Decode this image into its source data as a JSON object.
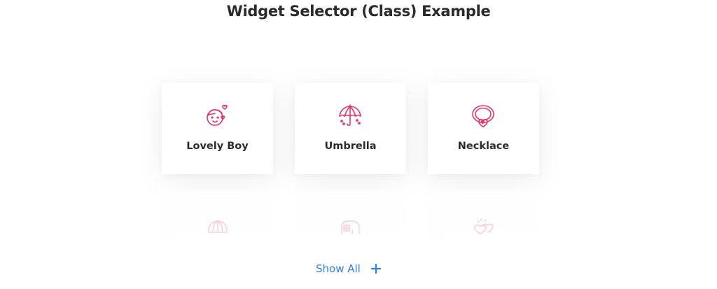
{
  "page": {
    "title": "Widget Selector (Class) Example"
  },
  "cards": [
    {
      "label": "Lovely Boy",
      "icon": "lovely-boy-icon"
    },
    {
      "label": "Umbrella",
      "icon": "umbrella-icon"
    },
    {
      "label": "Necklace",
      "icon": "necklace-icon"
    }
  ],
  "faded_cards": [
    {
      "icon": "shell-icon"
    },
    {
      "icon": "elephant-icon"
    },
    {
      "icon": "hearts-icon"
    }
  ],
  "show_all": {
    "label": "Show All",
    "icon": "plus-icon"
  },
  "colors": {
    "icon_accent": "#e8336b",
    "link": "#2f80ed",
    "text": "#2b2b2b"
  }
}
